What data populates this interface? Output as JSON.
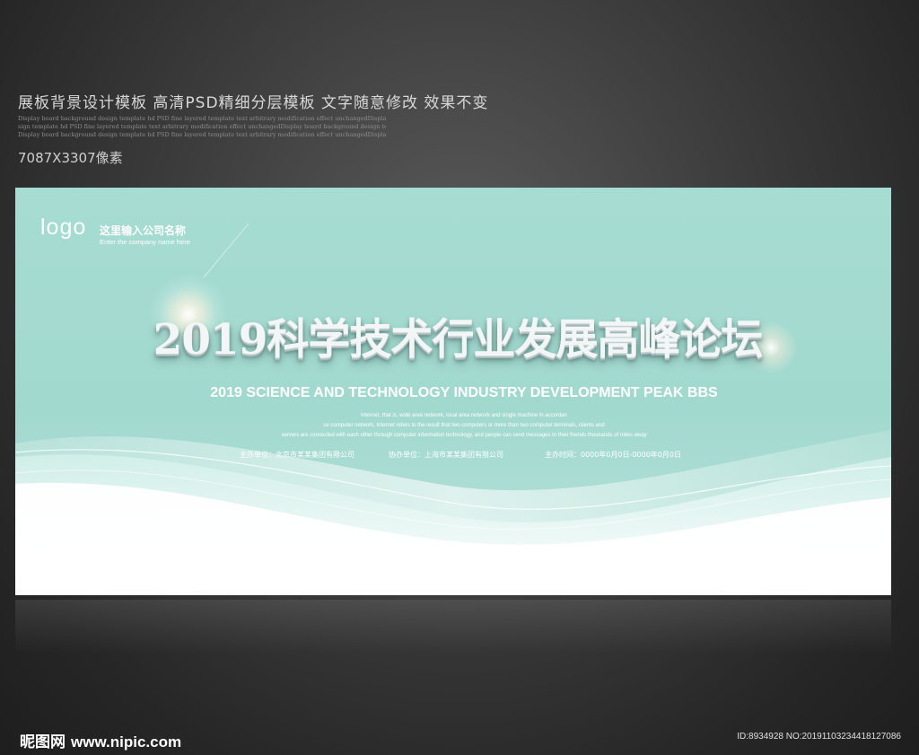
{
  "header": {
    "title": "展板背景设计模板  高清PSD精细分层模板 文字随意修改 效果不变",
    "description_lines": [
      "Display board background design template hd PSD fine layered template text arbitrary modification effect unchangedDisplay board background design template hd PSD fine layered template text arbitrary modification effect unchangedDisplay board background de",
      "sign template hd PSD fine layered template text arbitrary modification effect unchangedDisplay board background design template hd PSD fine layered template text arbitrary modification effect unchanged",
      "Display board background design template hd PSD fine layered template text arbitrary modification effect unchangedDisplay board background design template hd PSD fine layered template text arbitrary modification effect unchanged"
    ],
    "size": "7087X3307像素"
  },
  "board": {
    "logo": "logo",
    "company_cn": "这里输入公司名称",
    "company_en": "Enter the company name here",
    "title": "2019科学技术行业发展高峰论坛",
    "subtitle": "2019 SCIENCE AND TECHNOLOGY INDUSTRY DEVELOPMENT PEAK BBS",
    "description_lines": [
      "Internet, that is, wide area network, local area network and single machine in accordan",
      "ce computer network, Internet refers to the result that two computers or more than two computer terminals, clients and",
      "servers are connected with each other through computer information technology, and people can send messages to their friends thousands of miles away"
    ],
    "organizer": "主办单位：北京市某某集团有限公司",
    "co_organizer": "协办单位：上海市某某集团有限公司",
    "date": "主办时间：0000年0月0日-0000年0月0日"
  },
  "watermark": {
    "site_cn": "昵图网",
    "url": "www.nipic.com",
    "image_id": "ID:8934928 NO:20191103234418127086"
  },
  "colors": {
    "page_background": "#3a3a3a",
    "board_background": "#a6dcd2",
    "text_light": "#ffffff"
  }
}
